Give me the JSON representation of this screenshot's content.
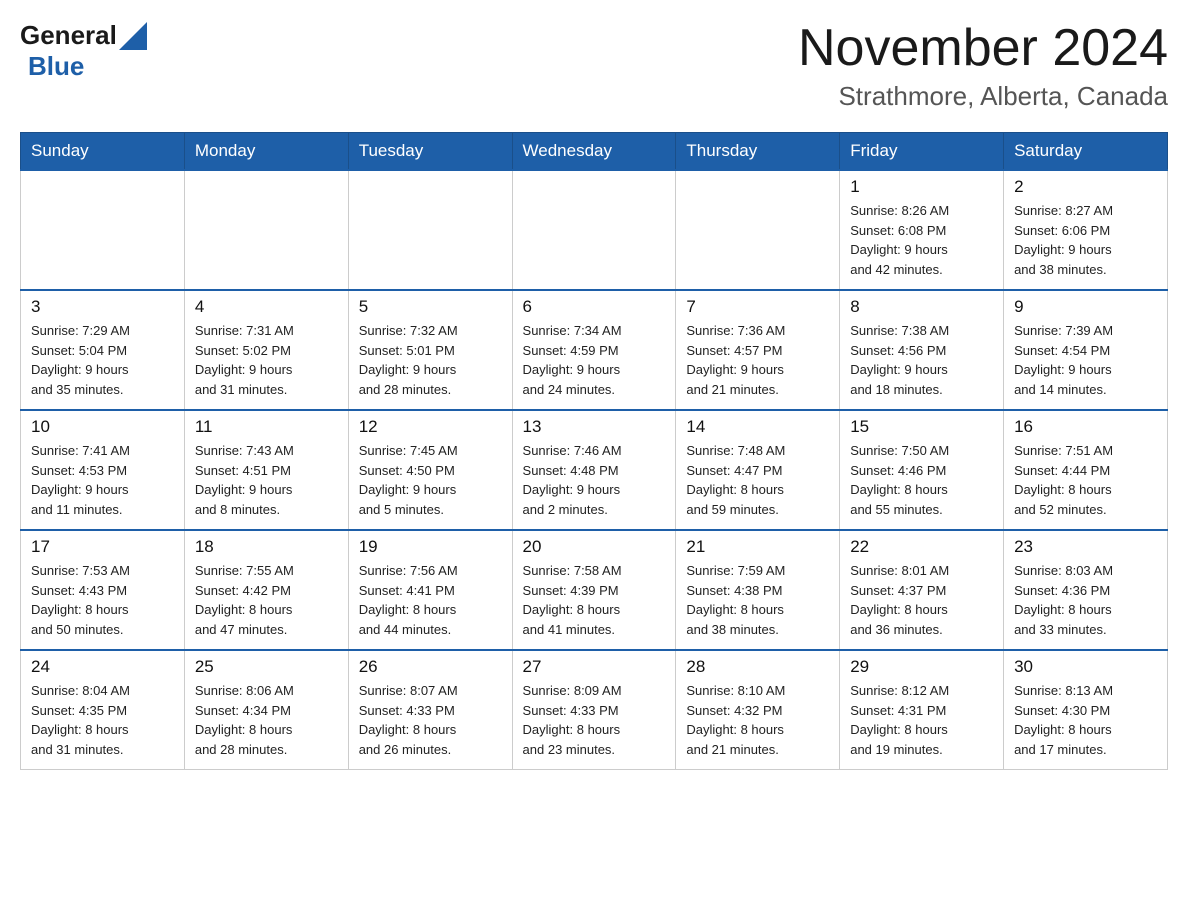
{
  "header": {
    "logo": {
      "part1": "General",
      "part2": "Blue"
    },
    "title": "November 2024",
    "location": "Strathmore, Alberta, Canada"
  },
  "days_of_week": [
    "Sunday",
    "Monday",
    "Tuesday",
    "Wednesday",
    "Thursday",
    "Friday",
    "Saturday"
  ],
  "weeks": [
    [
      {
        "day": "",
        "info": "",
        "empty": true
      },
      {
        "day": "",
        "info": "",
        "empty": true
      },
      {
        "day": "",
        "info": "",
        "empty": true
      },
      {
        "day": "",
        "info": "",
        "empty": true
      },
      {
        "day": "",
        "info": "",
        "empty": true
      },
      {
        "day": "1",
        "info": "Sunrise: 8:26 AM\nSunset: 6:08 PM\nDaylight: 9 hours\nand 42 minutes.",
        "empty": false
      },
      {
        "day": "2",
        "info": "Sunrise: 8:27 AM\nSunset: 6:06 PM\nDaylight: 9 hours\nand 38 minutes.",
        "empty": false
      }
    ],
    [
      {
        "day": "3",
        "info": "Sunrise: 7:29 AM\nSunset: 5:04 PM\nDaylight: 9 hours\nand 35 minutes.",
        "empty": false
      },
      {
        "day": "4",
        "info": "Sunrise: 7:31 AM\nSunset: 5:02 PM\nDaylight: 9 hours\nand 31 minutes.",
        "empty": false
      },
      {
        "day": "5",
        "info": "Sunrise: 7:32 AM\nSunset: 5:01 PM\nDaylight: 9 hours\nand 28 minutes.",
        "empty": false
      },
      {
        "day": "6",
        "info": "Sunrise: 7:34 AM\nSunset: 4:59 PM\nDaylight: 9 hours\nand 24 minutes.",
        "empty": false
      },
      {
        "day": "7",
        "info": "Sunrise: 7:36 AM\nSunset: 4:57 PM\nDaylight: 9 hours\nand 21 minutes.",
        "empty": false
      },
      {
        "day": "8",
        "info": "Sunrise: 7:38 AM\nSunset: 4:56 PM\nDaylight: 9 hours\nand 18 minutes.",
        "empty": false
      },
      {
        "day": "9",
        "info": "Sunrise: 7:39 AM\nSunset: 4:54 PM\nDaylight: 9 hours\nand 14 minutes.",
        "empty": false
      }
    ],
    [
      {
        "day": "10",
        "info": "Sunrise: 7:41 AM\nSunset: 4:53 PM\nDaylight: 9 hours\nand 11 minutes.",
        "empty": false
      },
      {
        "day": "11",
        "info": "Sunrise: 7:43 AM\nSunset: 4:51 PM\nDaylight: 9 hours\nand 8 minutes.",
        "empty": false
      },
      {
        "day": "12",
        "info": "Sunrise: 7:45 AM\nSunset: 4:50 PM\nDaylight: 9 hours\nand 5 minutes.",
        "empty": false
      },
      {
        "day": "13",
        "info": "Sunrise: 7:46 AM\nSunset: 4:48 PM\nDaylight: 9 hours\nand 2 minutes.",
        "empty": false
      },
      {
        "day": "14",
        "info": "Sunrise: 7:48 AM\nSunset: 4:47 PM\nDaylight: 8 hours\nand 59 minutes.",
        "empty": false
      },
      {
        "day": "15",
        "info": "Sunrise: 7:50 AM\nSunset: 4:46 PM\nDaylight: 8 hours\nand 55 minutes.",
        "empty": false
      },
      {
        "day": "16",
        "info": "Sunrise: 7:51 AM\nSunset: 4:44 PM\nDaylight: 8 hours\nand 52 minutes.",
        "empty": false
      }
    ],
    [
      {
        "day": "17",
        "info": "Sunrise: 7:53 AM\nSunset: 4:43 PM\nDaylight: 8 hours\nand 50 minutes.",
        "empty": false
      },
      {
        "day": "18",
        "info": "Sunrise: 7:55 AM\nSunset: 4:42 PM\nDaylight: 8 hours\nand 47 minutes.",
        "empty": false
      },
      {
        "day": "19",
        "info": "Sunrise: 7:56 AM\nSunset: 4:41 PM\nDaylight: 8 hours\nand 44 minutes.",
        "empty": false
      },
      {
        "day": "20",
        "info": "Sunrise: 7:58 AM\nSunset: 4:39 PM\nDaylight: 8 hours\nand 41 minutes.",
        "empty": false
      },
      {
        "day": "21",
        "info": "Sunrise: 7:59 AM\nSunset: 4:38 PM\nDaylight: 8 hours\nand 38 minutes.",
        "empty": false
      },
      {
        "day": "22",
        "info": "Sunrise: 8:01 AM\nSunset: 4:37 PM\nDaylight: 8 hours\nand 36 minutes.",
        "empty": false
      },
      {
        "day": "23",
        "info": "Sunrise: 8:03 AM\nSunset: 4:36 PM\nDaylight: 8 hours\nand 33 minutes.",
        "empty": false
      }
    ],
    [
      {
        "day": "24",
        "info": "Sunrise: 8:04 AM\nSunset: 4:35 PM\nDaylight: 8 hours\nand 31 minutes.",
        "empty": false
      },
      {
        "day": "25",
        "info": "Sunrise: 8:06 AM\nSunset: 4:34 PM\nDaylight: 8 hours\nand 28 minutes.",
        "empty": false
      },
      {
        "day": "26",
        "info": "Sunrise: 8:07 AM\nSunset: 4:33 PM\nDaylight: 8 hours\nand 26 minutes.",
        "empty": false
      },
      {
        "day": "27",
        "info": "Sunrise: 8:09 AM\nSunset: 4:33 PM\nDaylight: 8 hours\nand 23 minutes.",
        "empty": false
      },
      {
        "day": "28",
        "info": "Sunrise: 8:10 AM\nSunset: 4:32 PM\nDaylight: 8 hours\nand 21 minutes.",
        "empty": false
      },
      {
        "day": "29",
        "info": "Sunrise: 8:12 AM\nSunset: 4:31 PM\nDaylight: 8 hours\nand 19 minutes.",
        "empty": false
      },
      {
        "day": "30",
        "info": "Sunrise: 8:13 AM\nSunset: 4:30 PM\nDaylight: 8 hours\nand 17 minutes.",
        "empty": false
      }
    ]
  ]
}
